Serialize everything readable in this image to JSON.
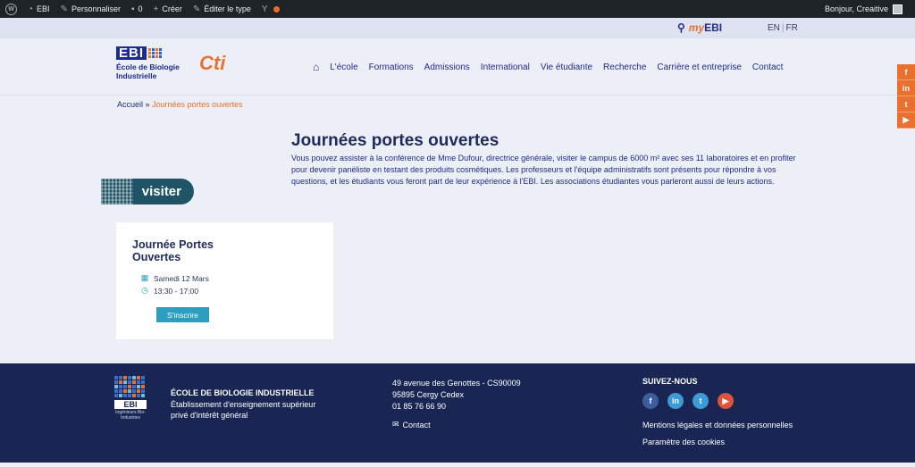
{
  "adminbar": {
    "site": "EBI",
    "customize": "Personnaliser",
    "comments": "0",
    "create": "Créer",
    "edit_type": "Éditer le type",
    "greeting": "Bonjour, Creaitive"
  },
  "utility": {
    "myebi_my": "my",
    "myebi_ebi": "EBI",
    "lang_en": "EN",
    "lang_fr": "FR"
  },
  "logo": {
    "mark": "EBI",
    "line1": "École de Biologie",
    "line2": "Industrielle",
    "cti": "Cti"
  },
  "nav": {
    "items": [
      "L'école",
      "Formations",
      "Admissions",
      "International",
      "Vie étudiante",
      "Recherche",
      "Carrière et entreprise",
      "Contact"
    ]
  },
  "social_side": [
    "f",
    "in",
    "t",
    "▶"
  ],
  "breadcrumb": {
    "home": "Accueil",
    "sep": " » ",
    "current": "Journées portes ouvertes"
  },
  "main": {
    "title": "Journées portes ouvertes",
    "intro": "Vous pouvez assister à la conférence de Mme Dufour, directrice générale, visiter le campus de 6000 m² avec ses 11 laboratoires et en profiter pour devenir panéliste en testant des produits cosmétiques. Les professeurs et l'équipe administratifs sont présents pour répondre à vos questions, et les étudiants vous feront part de leur expérience à l'EBI. Les associations étudiantes vous parleront aussi de leurs actions.",
    "visiter": "visiter"
  },
  "event": {
    "title": "Journée Portes Ouvertes",
    "date": "Samedi 12 Mars",
    "time": "13:30 - 17:00",
    "button": "S'inscrire"
  },
  "footer": {
    "ebi": "EBI",
    "ebi_sub": "Ingénieurs Bio-Industries",
    "school_name": "ÉCOLE DE BIOLOGIE INDUSTRIELLE",
    "school_desc": "Établissement d'enseignement supérieur privé d'intérêt général",
    "address1": "49 avenue des Genottes - CS90009",
    "address2": "95895 Cergy Cedex",
    "phone": "01 85 76 66 90",
    "contact": "Contact",
    "follow": "SUIVEZ-NOUS",
    "legal": "Mentions légales et données personnelles",
    "cookies": "Paramètre des cookies"
  },
  "colors": {
    "navy": "#1e2a5e",
    "orange": "#e9702e",
    "footer_bg": "#192653",
    "teal": "#2a9fc0"
  }
}
